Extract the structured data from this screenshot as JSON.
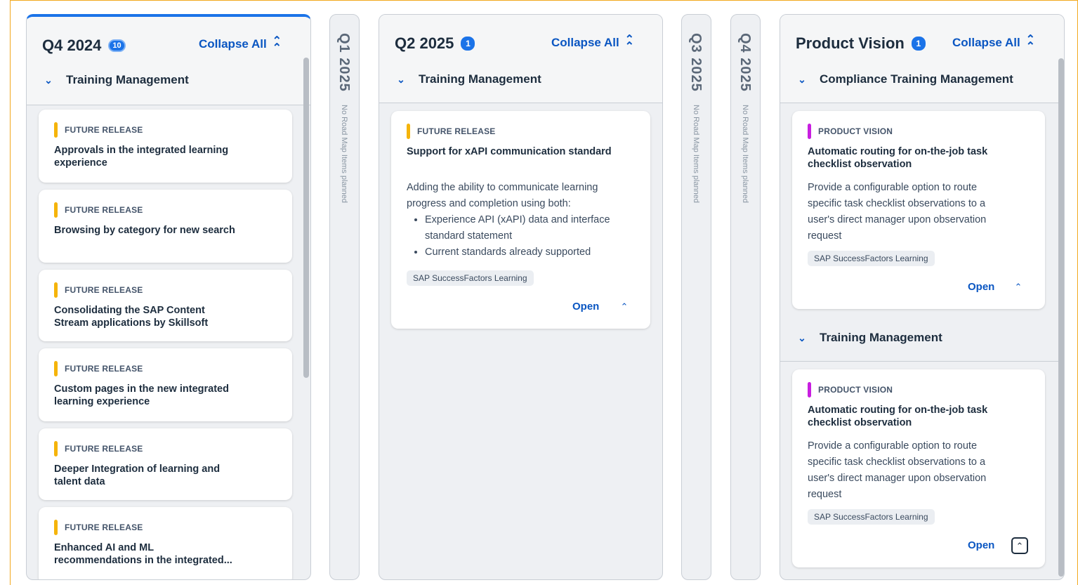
{
  "columns": {
    "q4_2024": {
      "title": "Q4 2024",
      "count": "10",
      "collapse_label": "Collapse All",
      "group": "Training Management",
      "cards": [
        {
          "tag": "FUTURE RELEASE",
          "title_l1": "Approvals in the integrated learning",
          "title_l2": "experience"
        },
        {
          "tag": "FUTURE RELEASE",
          "title_l1": "Browsing by category for new search",
          "title_l2": ""
        },
        {
          "tag": "FUTURE RELEASE",
          "title_l1": "Consolidating the SAP Content",
          "title_l2": "Stream applications by Skillsoft"
        },
        {
          "tag": "FUTURE RELEASE",
          "title_l1": "Custom pages in the new integrated",
          "title_l2": "learning experience"
        },
        {
          "tag": "FUTURE RELEASE",
          "title_l1": "Deeper Integration of learning and",
          "title_l2": "talent data"
        },
        {
          "tag": "FUTURE RELEASE",
          "title_l1": "Enhanced AI and ML",
          "title_l2": "recommendations in the integrated..."
        }
      ]
    },
    "q1_2025": {
      "title": "Q1 2025",
      "note": "No Road Map Items planned"
    },
    "q2_2025": {
      "title": "Q2 2025",
      "count": "1",
      "collapse_label": "Collapse All",
      "group": "Training Management",
      "card": {
        "tag": "FUTURE RELEASE",
        "title": "Support for xAPI communication standard",
        "desc_l1": "Adding the ability to communicate learning",
        "desc_l2": "progress and completion using both:",
        "bullet1_l1": "Experience API (xAPI) data and interface",
        "bullet1_l2": "standard statement",
        "bullet2": "Current standards already supported",
        "chip": "SAP SuccessFactors Learning",
        "open": "Open"
      }
    },
    "q3_2025": {
      "title": "Q3 2025",
      "note": "No Road Map Items planned"
    },
    "q4_2025": {
      "title": "Q4 2025",
      "note": "No Road Map Items planned"
    },
    "product_vision": {
      "title": "Product Vision",
      "count": "1",
      "collapse_label": "Collapse All",
      "groups": [
        {
          "name": "Compliance Training Management",
          "card": {
            "tag": "PRODUCT VISION",
            "title_l1": "Automatic routing for on-the-job task",
            "title_l2": "checklist observation",
            "desc_l1": "Provide a configurable option to route",
            "desc_l2": "specific task checklist observations to a",
            "desc_l3": "user's direct manager upon observation",
            "desc_l4": "request",
            "chip": "SAP SuccessFactors Learning",
            "open": "Open"
          }
        },
        {
          "name": "Training Management",
          "card": {
            "tag": "PRODUCT VISION",
            "title_l1": "Automatic routing for on-the-job task",
            "title_l2": "checklist observation",
            "desc_l1": "Provide a configurable option to route",
            "desc_l2": "specific task checklist observations to a",
            "desc_l3": "user's direct manager upon observation",
            "desc_l4": "request",
            "chip": "SAP SuccessFactors Learning",
            "open": "Open"
          }
        }
      ]
    }
  },
  "icons": {
    "collapse_all": "double-chevron-up-icon",
    "group_toggle": "chevron-down-icon",
    "card_toggle": "chevron-up-icon"
  },
  "colors": {
    "accent": "#0a56c2",
    "future_release": "#f5b40a",
    "product_vision": "#c81ee0",
    "selected_column": "#1b73e8",
    "frame_highlight": "#f2a81d"
  }
}
